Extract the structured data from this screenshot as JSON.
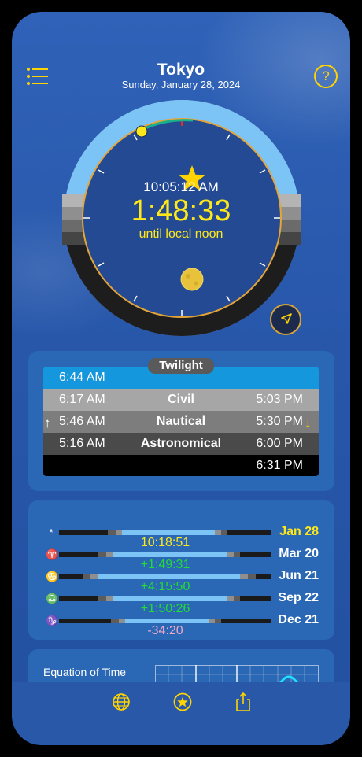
{
  "header": {
    "city": "Tokyo",
    "date": "Sunday, January 28, 2024"
  },
  "clock": {
    "current_time": "10:05:12 AM",
    "countdown": "1:48:33",
    "countdown_label": "until local noon"
  },
  "twilight": {
    "title": "Twilight",
    "rows": [
      {
        "name": "",
        "morning": "6:44 AM",
        "evening": "",
        "color": "#1497dc"
      },
      {
        "name": "Civil",
        "morning": "6:17 AM",
        "evening": "5:03 PM",
        "color": "#a6a6a6"
      },
      {
        "name": "Nautical",
        "morning": "5:46 AM",
        "evening": "5:30 PM",
        "color": "#7d7d7d"
      },
      {
        "name": "Astronomical",
        "morning": "5:16 AM",
        "evening": "6:00 PM",
        "color": "#4a4a4a"
      },
      {
        "name": "",
        "morning": "",
        "evening": "6:31 PM",
        "color": "#000000"
      }
    ],
    "up_arrow": "↑",
    "down_arrow": "↓"
  },
  "seasons": [
    {
      "glyph": "*",
      "date": "Jan 28",
      "date_color": "#ffe81a",
      "day_length": "10:18:51",
      "value_color": "#ffe81a"
    },
    {
      "glyph": "♈",
      "date": "Mar 20",
      "date_color": "#ffffff",
      "day_length": "+1:49:31",
      "value_color": "#22dd33"
    },
    {
      "glyph": "♋",
      "date": "Jun 21",
      "date_color": "#ffffff",
      "day_length": "+4:15:50",
      "value_color": "#22dd33"
    },
    {
      "glyph": "♎",
      "date": "Sep 22",
      "date_color": "#ffffff",
      "day_length": "+1:50:26",
      "value_color": "#22dd33"
    },
    {
      "glyph": "♑",
      "date": "Dec 21",
      "date_color": "#ffffff",
      "day_length": "-34:20",
      "value_color": "#f0a8c8"
    }
  ],
  "equation_of_time": {
    "label": "Equation of Time"
  },
  "icons": {
    "menu": "list-icon",
    "help": "question-icon",
    "help_glyph": "?",
    "locate": "location-arrow-icon",
    "globe": "globe-icon",
    "favorites": "star-circle-icon",
    "share": "share-icon"
  },
  "colors": {
    "accent": "#ffd400",
    "sky": "#2a5aa8",
    "day_arc": "#7cc4f6",
    "night_arc": "#1d1d1d"
  }
}
